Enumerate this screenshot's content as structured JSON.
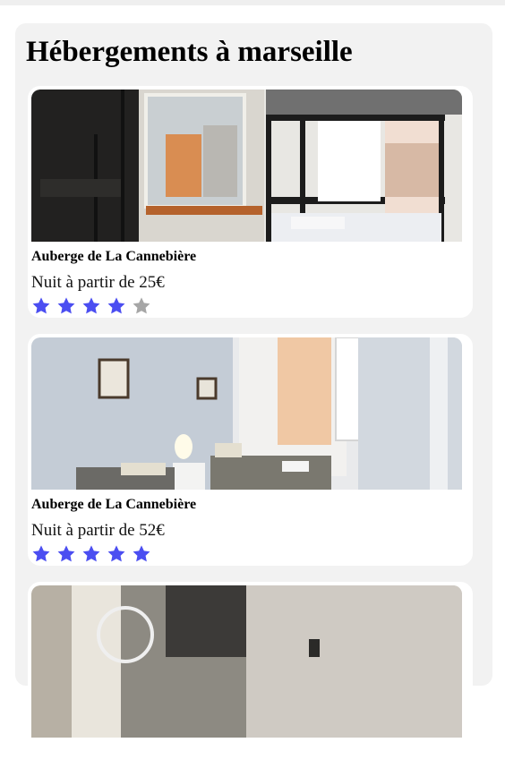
{
  "page": {
    "title": "Hébergements à marseille"
  },
  "colors": {
    "star_filled": "#4b4ef1",
    "star_empty": "#a6a6a6",
    "panel_bg": "#f2f2f2"
  },
  "listings": [
    {
      "name": "Auberge de La Cannebière",
      "price_text": "Nuit à partir de 25€",
      "rating": 4,
      "rating_max": 5,
      "photo": "dormitory-bunk-bed-photo"
    },
    {
      "name": "Auberge de La Cannebière",
      "price_text": "Nuit à partir de 52€",
      "rating": 5,
      "rating_max": 5,
      "photo": "twin-room-photo"
    },
    {
      "photo": "room-photo"
    }
  ]
}
